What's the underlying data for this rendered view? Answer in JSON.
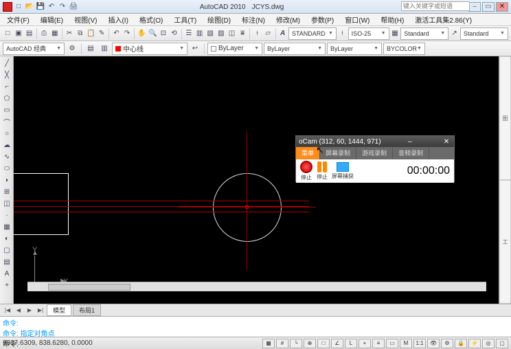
{
  "title": {
    "app": "AutoCAD 2010",
    "file": "JCYS.dwg"
  },
  "search_placeholder": "键入关键字或短语",
  "menu": [
    "文件(F)",
    "编辑(E)",
    "视图(V)",
    "插入(I)",
    "格式(O)",
    "工具(T)",
    "绘图(D)",
    "标注(N)",
    "修改(M)",
    "参数(P)",
    "窗口(W)",
    "帮助(H)",
    "激活工具集2.86(Y)"
  ],
  "toolbar1_dropdowns": {
    "textstyle": "STANDARD",
    "dimstyle": "ISO-25",
    "tablestyle": "Standard",
    "mlstyle": "Standard"
  },
  "toolbar2": {
    "workspace": "AutoCAD 经典",
    "layer": "中心线",
    "linetype": "ByLayer",
    "lineweight": "ByLayer",
    "color": "BYCOLOR"
  },
  "tabs": {
    "nav": [
      "|◀",
      "◀",
      "▶",
      "▶|"
    ],
    "t1": "模型",
    "t2": "布局1"
  },
  "cmd": {
    "l1": "命令:",
    "l2": "命令: 指定对角点",
    "l3": "命令:"
  },
  "status": {
    "coords": "9337.6309, 838.6280, 0.0000",
    "scale": "1:1",
    "angle": "▲"
  },
  "ucs": {
    "x": "X",
    "y": "Y"
  },
  "ocam": {
    "title": "oCam (312, 60, 1444, 971)",
    "tabs": [
      "菜单",
      "屏幕录制",
      "游戏录制",
      "音频录制"
    ],
    "btns": {
      "stop": "停止",
      "pause": "停止",
      "capture": "屏幕捕获"
    },
    "timer": "00:00:00"
  },
  "right_tabs": [
    "图",
    "工"
  ]
}
